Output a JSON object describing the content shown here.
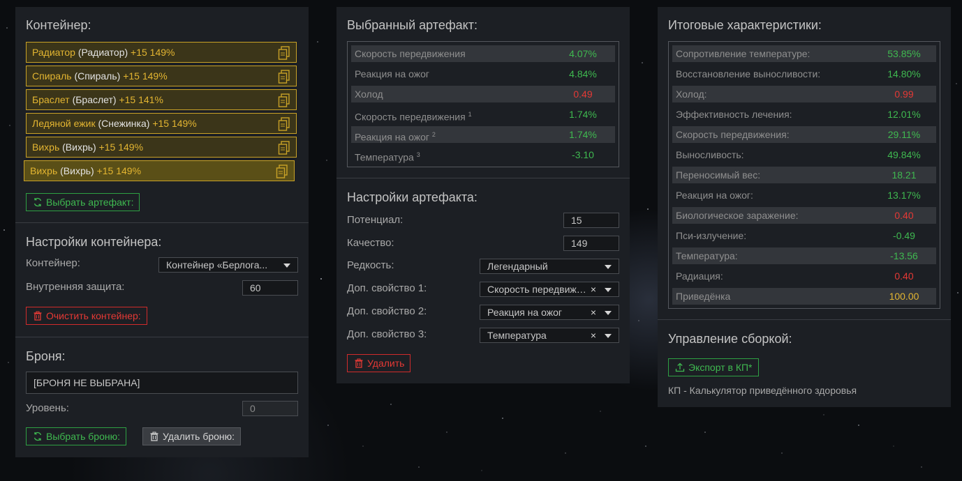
{
  "left": {
    "container_title": "Контейнер:",
    "items": [
      {
        "name": "Радиатор",
        "sub": "(Радиатор)",
        "pct": "+15 149%"
      },
      {
        "name": "Спираль",
        "sub": "(Спираль)",
        "pct": "+15 149%"
      },
      {
        "name": "Браслет",
        "sub": "(Браслет)",
        "pct": "+15 141%"
      },
      {
        "name": "Ледяной ежик",
        "sub": "(Снежинка)",
        "pct": "+15 149%"
      },
      {
        "name": "Вихрь",
        "sub": "(Вихрь)",
        "pct": "+15 149%"
      },
      {
        "name": "Вихрь",
        "sub": "(Вихрь)",
        "pct": "+15 149%"
      }
    ],
    "select_artifact_label": "Выбрать артефакт:",
    "container_settings_title": "Настройки контейнера:",
    "container_label": "Контейнер:",
    "container_value": "Контейнер «Берлога...",
    "inner_protection_label": "Внутренняя защита:",
    "inner_protection_value": "60",
    "clear_container_label": "Очистить контейнер:",
    "armor_title": "Броня:",
    "armor_value": "[БРОНЯ НЕ ВЫБРАНА]",
    "level_label": "Уровень:",
    "level_value": "0",
    "select_armor_label": "Выбрать броню:",
    "delete_armor_label": "Удалить броню:"
  },
  "middle": {
    "selected_title": "Выбранный артефакт:",
    "stats": [
      {
        "label": "Скорость передвижения",
        "sup": "",
        "value": "4.07%",
        "color": "green"
      },
      {
        "label": "Реакция на ожог",
        "sup": "",
        "value": "4.84%",
        "color": "green"
      },
      {
        "label": "Холод",
        "sup": "",
        "value": "0.49",
        "color": "red"
      },
      {
        "label": "Скорость передвижения",
        "sup": "1",
        "value": "1.74%",
        "color": "green"
      },
      {
        "label": "Реакция на ожог",
        "sup": "2",
        "value": "1.74%",
        "color": "green"
      },
      {
        "label": "Температура",
        "sup": "3",
        "value": "-3.10",
        "color": "green"
      }
    ],
    "settings_title": "Настройки артефакта:",
    "potential_label": "Потенциал:",
    "potential_value": "15",
    "quality_label": "Качество:",
    "quality_value": "149",
    "rarity_label": "Редкость:",
    "rarity_value": "Легендарный",
    "prop1_label": "Доп. свойство 1:",
    "prop1_value": "Скорость передвижения",
    "prop2_label": "Доп. свойство 2:",
    "prop2_value": "Реакция на ожог",
    "prop3_label": "Доп. свойство 3:",
    "prop3_value": "Температура",
    "clear_symbol": "×",
    "delete_label": "Удалить"
  },
  "right": {
    "totals_title": "Итоговые характеристики:",
    "stats": [
      {
        "label": "Сопротивление температуре:",
        "value": "53.85%",
        "color": "green"
      },
      {
        "label": "Восстановление выносливости:",
        "value": "14.80%",
        "color": "green"
      },
      {
        "label": "Холод:",
        "value": "0.99",
        "color": "red"
      },
      {
        "label": "Эффективность лечения:",
        "value": "12.01%",
        "color": "green"
      },
      {
        "label": "Скорость передвижения:",
        "value": "29.11%",
        "color": "green"
      },
      {
        "label": "Выносливость:",
        "value": "49.84%",
        "color": "green"
      },
      {
        "label": "Переносимый вес:",
        "value": "18.21",
        "color": "green"
      },
      {
        "label": "Реакция на ожог:",
        "value": "13.17%",
        "color": "green"
      },
      {
        "label": "Биологическое заражение:",
        "value": "0.40",
        "color": "red"
      },
      {
        "label": "Пси-излучение:",
        "value": "-0.49",
        "color": "green"
      },
      {
        "label": "Температура:",
        "value": "-13.56",
        "color": "green"
      },
      {
        "label": "Радиация:",
        "value": "0.40",
        "color": "red"
      },
      {
        "label": "Приведёнка",
        "value": "100.00",
        "color": "yellow"
      }
    ],
    "build_title": "Управление сборкой:",
    "export_label": "Экспорт в КП*",
    "footnote": "КП - Калькулятор приведённого здоровья"
  }
}
